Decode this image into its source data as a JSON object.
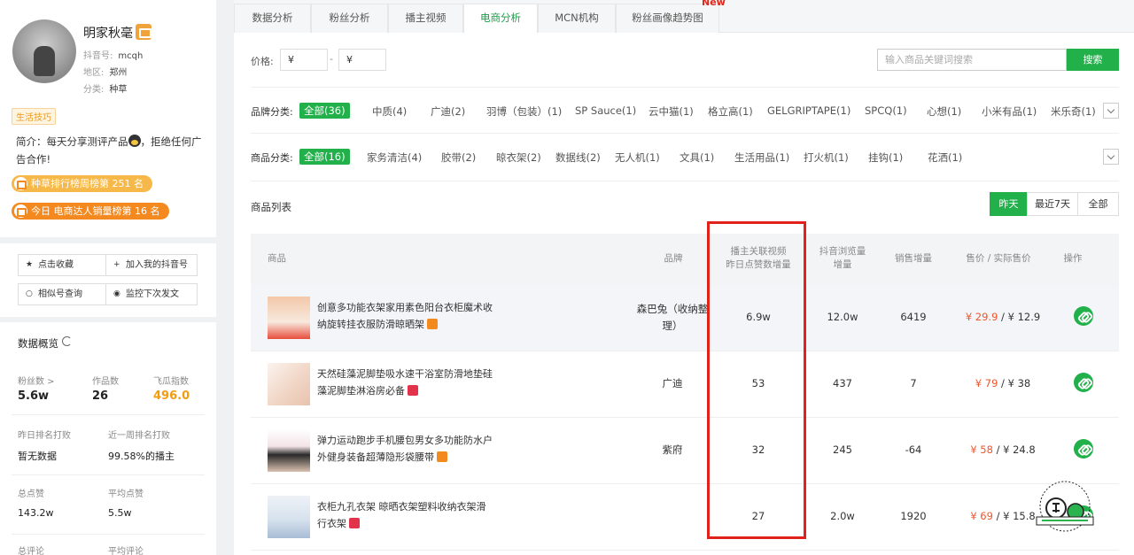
{
  "profile": {
    "name": "明家秋毫",
    "douyin_label": "抖音号:",
    "douyin_id": "mcqh",
    "region_label": "地区:",
    "region": "郑州",
    "category_label": "分类:",
    "category": "种草",
    "tag": "生活技巧",
    "intro_prefix": "简介：每天分享测评产品",
    "intro_suffix": "，拒绝任何广告合作!",
    "rank1": "种草排行榜周榜第 251 名",
    "rank2": "今日 电商达人销量榜第 16 名"
  },
  "actions": {
    "favorite": "点击收藏",
    "add_mine": "加入我的抖音号",
    "similar": "相似号查询",
    "monitor": "监控下次发文"
  },
  "overview": {
    "title": "数据概览",
    "fans_label": "粉丝数 >",
    "fans": "5.6w",
    "works_label": "作品数",
    "works": "26",
    "index_label": "飞瓜指数",
    "index": "496.0",
    "yesterday_rank_label": "昨日排名打败",
    "yesterday_rank": "暂无数据",
    "week_rank_label": "近一周排名打败",
    "week_rank": "99.58%的播主",
    "total_likes_label": "总点赞",
    "total_likes": "143.2w",
    "avg_likes_label": "平均点赞",
    "avg_likes": "5.5w",
    "total_comments_label": "总评论",
    "avg_comments_label": "平均评论"
  },
  "tabs": [
    "数据分析",
    "粉丝分析",
    "播主视频",
    "电商分析",
    "MCN机构",
    "粉丝画像趋势图"
  ],
  "new_tag": "New",
  "price_filter": {
    "label": "价格:",
    "from": "¥",
    "to": "¥",
    "dash": "-"
  },
  "search": {
    "placeholder": "输入商品关键词搜索",
    "button": "搜索"
  },
  "brand_filter": {
    "label": "品牌分类:",
    "items": [
      "全部(36)",
      "中质(4)",
      "广迪(2)",
      "羽博（包装）(1)",
      "SP Sauce(1)",
      "云中猫(1)",
      "格立高(1)",
      "GELGRIPTAPE(1)",
      "SPCQ(1)",
      "心想(1)",
      "小米有品(1)",
      "米乐奇(1)"
    ]
  },
  "goods_filter": {
    "label": "商品分类:",
    "items": [
      "全部(16)",
      "家务清洁(4)",
      "胶带(2)",
      "晾衣架(2)",
      "数据线(2)",
      "无人机(1)",
      "文具(1)",
      "生活用品(1)",
      "打火机(1)",
      "挂钩(1)",
      "花洒(1)"
    ]
  },
  "list": {
    "title": "商品列表",
    "ranges": [
      "昨天",
      "最近7天",
      "全部"
    ],
    "headers": {
      "product": "商品",
      "brand": "品牌",
      "likes_line1": "播主关联视频",
      "likes_line2": "昨日点赞数增量",
      "views_line1": "抖音浏览量",
      "views_line2": "增量",
      "sales": "销售增量",
      "price": "售价 / 实际售价",
      "op": "操作"
    },
    "rows": [
      {
        "name": "创意多功能衣架家用素色阳台衣柜魔术收纳旋转挂衣服防滑晾晒架",
        "shop": "taobao",
        "brand": "森巴兔（收纳整理）",
        "likes": "6.9w",
        "views": "12.0w",
        "sales": "6419",
        "price": "¥ 29.9",
        "actual": " / ¥ 12.9"
      },
      {
        "name": "天然硅藻泥脚垫吸水速干浴室防滑地垫硅藻泥脚垫淋浴房必备",
        "shop": "tmall",
        "brand": "广迪",
        "likes": "53",
        "views": "437",
        "sales": "7",
        "price": "¥ 79",
        "actual": " / ¥ 38"
      },
      {
        "name": "弹力运动跑步手机腰包男女多功能防水户外健身装备超薄隐形袋腰带",
        "shop": "taobao",
        "brand": "紫府",
        "likes": "32",
        "views": "245",
        "sales": "-64",
        "price": "¥ 58",
        "actual": " / ¥ 24.8"
      },
      {
        "name": "衣柜九孔衣架 晾晒衣架塑料收纳衣架滑行衣架",
        "shop": "tmall",
        "brand": "",
        "likes": "27",
        "views": "2.0w",
        "sales": "1920",
        "price": "¥ 69",
        "actual": " / ¥ 15.8"
      }
    ]
  },
  "colors": {
    "accent": "#22b04b",
    "highlight_box": "#e0221b",
    "price": "#f0542d",
    "index": "#f39c12"
  }
}
